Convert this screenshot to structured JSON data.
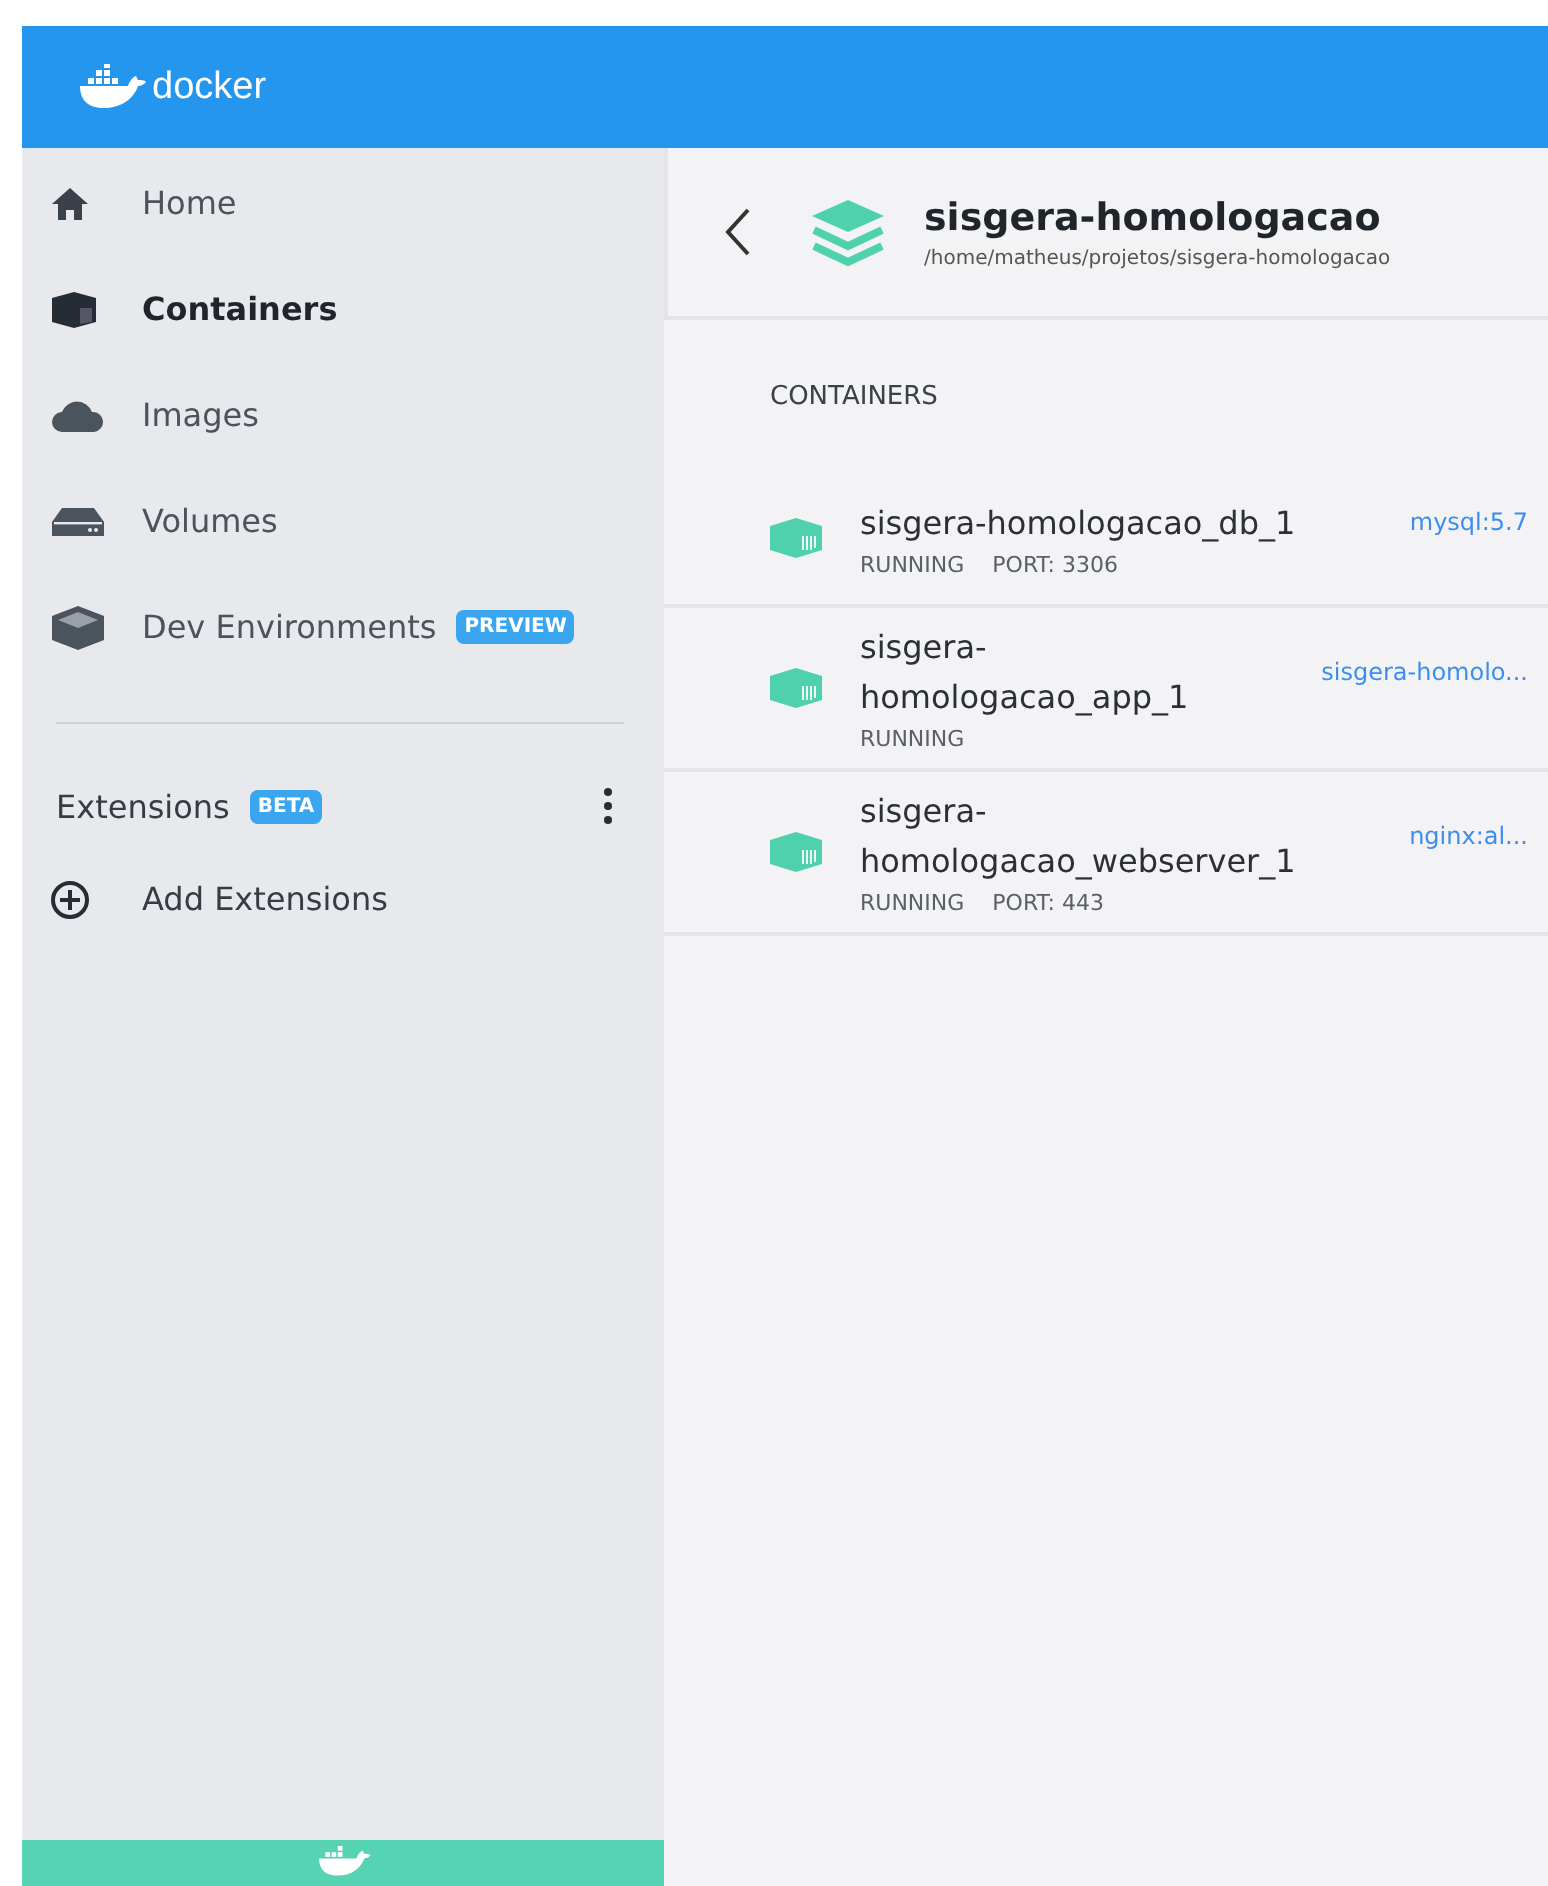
{
  "header": {
    "logo": "docker"
  },
  "sidebar": {
    "items": [
      {
        "label": "Home",
        "kind": "home",
        "selected": false
      },
      {
        "label": "Containers",
        "kind": "container",
        "selected": true
      },
      {
        "label": "Images",
        "kind": "cloud",
        "selected": false
      },
      {
        "label": "Volumes",
        "kind": "drive",
        "selected": false
      },
      {
        "label": "Dev Environments",
        "kind": "box",
        "selected": false,
        "badge": "PREVIEW"
      }
    ],
    "extensions": {
      "label": "Extensions",
      "badge": "BETA",
      "add": "Add Extensions"
    }
  },
  "app": {
    "title": "sisgera-homologacao",
    "path": "/home/matheus/projetos/sisgera-homologacao"
  },
  "section_title": "CONTAINERS",
  "containers": [
    {
      "name": "sisgera-homologacao_db_1",
      "image": "mysql:5.7",
      "status": "RUNNING",
      "port": "PORT: 3306"
    },
    {
      "name": "sisgera-homologacao_app_1",
      "image": "sisgera-homolo...",
      "status": "RUNNING"
    },
    {
      "name": "sisgera-homologacao_webserver_1",
      "image": "nginx:al...",
      "status": "RUNNING",
      "port": "PORT: 443"
    }
  ]
}
